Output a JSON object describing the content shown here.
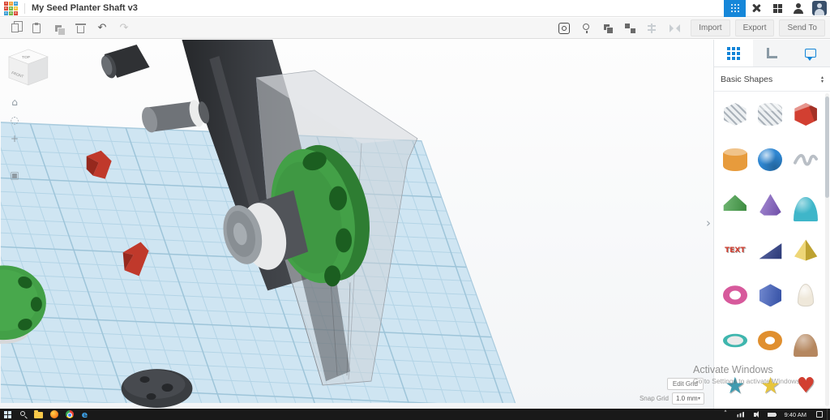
{
  "icons": {
    "undo": "↶",
    "redo": "↷",
    "home": "⌂",
    "fit_view": "◌",
    "zoom_in": "+",
    "grid_settings": "▣",
    "panel_handle": "›",
    "caret_up": "▴",
    "caret_down": "▾",
    "snap_caret": "▾",
    "tray_chevron": "˄",
    "edge_e": "e"
  },
  "top_bar": {
    "title": "My Seed Planter Shaft v3",
    "logo_tiles": [
      {
        "ch": "T",
        "color": "#d94a38"
      },
      {
        "ch": "I",
        "color": "#f2a33c"
      },
      {
        "ch": "N",
        "color": "#3e9fd4"
      },
      {
        "ch": "K",
        "color": "#d94a38"
      },
      {
        "ch": "E",
        "color": "#79b647"
      },
      {
        "ch": "R",
        "color": "#f2c53c"
      },
      {
        "ch": "C",
        "color": "#3e9fd4"
      },
      {
        "ch": "A",
        "color": "#79b647"
      },
      {
        "ch": "D",
        "color": "#d94a38"
      }
    ]
  },
  "toolbar": {
    "buttons": [
      {
        "label": "Import"
      },
      {
        "label": "Export"
      },
      {
        "label": "Send To"
      }
    ]
  },
  "viewport": {
    "view_cube": {
      "top": "TOP",
      "front": "FRONT"
    },
    "edit_grid_label": "Edit Grid",
    "snap_grid_label": "Snap Grid",
    "snap_grid_value": "1.0 mm"
  },
  "shapes_panel": {
    "category": "Basic Shapes",
    "shapes": [
      {
        "name": "box-hole",
        "type": "box",
        "color": "#e9ecef",
        "hatch": true
      },
      {
        "name": "cylinder-hole",
        "type": "cylinder",
        "color": "#e9ecef",
        "hatch": true
      },
      {
        "name": "box",
        "type": "box",
        "color": "#d23f31"
      },
      {
        "name": "cylinder",
        "type": "cylinder",
        "color": "#e79b3c"
      },
      {
        "name": "sphere",
        "type": "sphere",
        "color": "#2e86d1"
      },
      {
        "name": "scribble",
        "type": "scribble",
        "color": "#b9bfc6"
      },
      {
        "name": "roof",
        "type": "roof",
        "color": "#43a047"
      },
      {
        "name": "cone",
        "type": "cone",
        "color": "#7e57c2"
      },
      {
        "name": "half-sphere",
        "type": "half-sphere",
        "color": "#3fb6c9"
      },
      {
        "name": "text",
        "type": "text",
        "color": "#d23f31",
        "glyph": "TEXT"
      },
      {
        "name": "wedge",
        "type": "wedge",
        "color": "#30418f"
      },
      {
        "name": "pyramid",
        "type": "pyramid",
        "color": "#e7c53c"
      },
      {
        "name": "torus",
        "type": "torus",
        "color": "#d75a9c"
      },
      {
        "name": "polygon",
        "type": "polygon",
        "color": "#3a5bbf"
      },
      {
        "name": "paraboloid",
        "type": "paraboloid",
        "color": "#efe8da"
      },
      {
        "name": "tube",
        "type": "tube",
        "color": "#3fb6ae"
      },
      {
        "name": "donut",
        "type": "donut",
        "color": "#e08f2f"
      },
      {
        "name": "dome",
        "type": "dome",
        "color": "#b5875f"
      },
      {
        "name": "star",
        "type": "star",
        "color": "#3f9bb0",
        "glyph": "★"
      },
      {
        "name": "star-yellow",
        "type": "star",
        "color": "#e7c53c",
        "glyph": "★"
      },
      {
        "name": "heart",
        "type": "heart",
        "color": "#d23f31",
        "glyph": "♥"
      }
    ]
  },
  "watermark": {
    "line1": "Activate Windows",
    "line2": "Go to Settings to activate Windows."
  },
  "taskbar": {
    "time": "9:40 AM"
  }
}
